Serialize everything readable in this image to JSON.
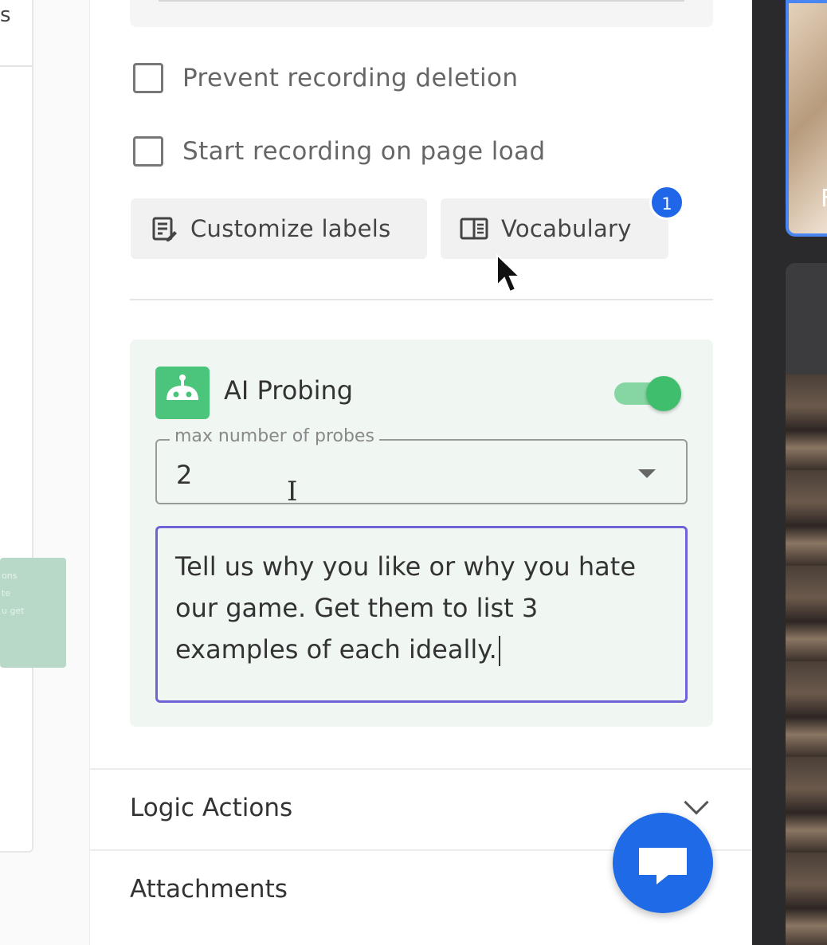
{
  "left_panel": {
    "edge_char": "s",
    "note_lines": [
      "ons",
      "te",
      "u get"
    ]
  },
  "checkboxes": [
    {
      "label": "Prevent recording deletion",
      "checked": false
    },
    {
      "label": "Start recording on page load",
      "checked": false
    }
  ],
  "buttons": {
    "customize_labels": "Customize labels",
    "vocabulary": "Vocabulary",
    "vocabulary_badge": "1"
  },
  "ai_probing": {
    "title": "AI Probing",
    "enabled": true,
    "max_probes_label": "max number of probes",
    "max_probes_value": "2",
    "prompt": "Tell us why you like or why you hate our game. Get them to list 3 examples of each ideally."
  },
  "sections": {
    "logic_actions": "Logic Actions",
    "attachments": "Attachments"
  },
  "video_tiles": {
    "tile_1_label": "F"
  },
  "colors": {
    "accent_green": "#4bc47c",
    "focus_purple": "#6e64d8",
    "fab_blue": "#1f6ae6",
    "badge_blue": "#1f66e8"
  }
}
